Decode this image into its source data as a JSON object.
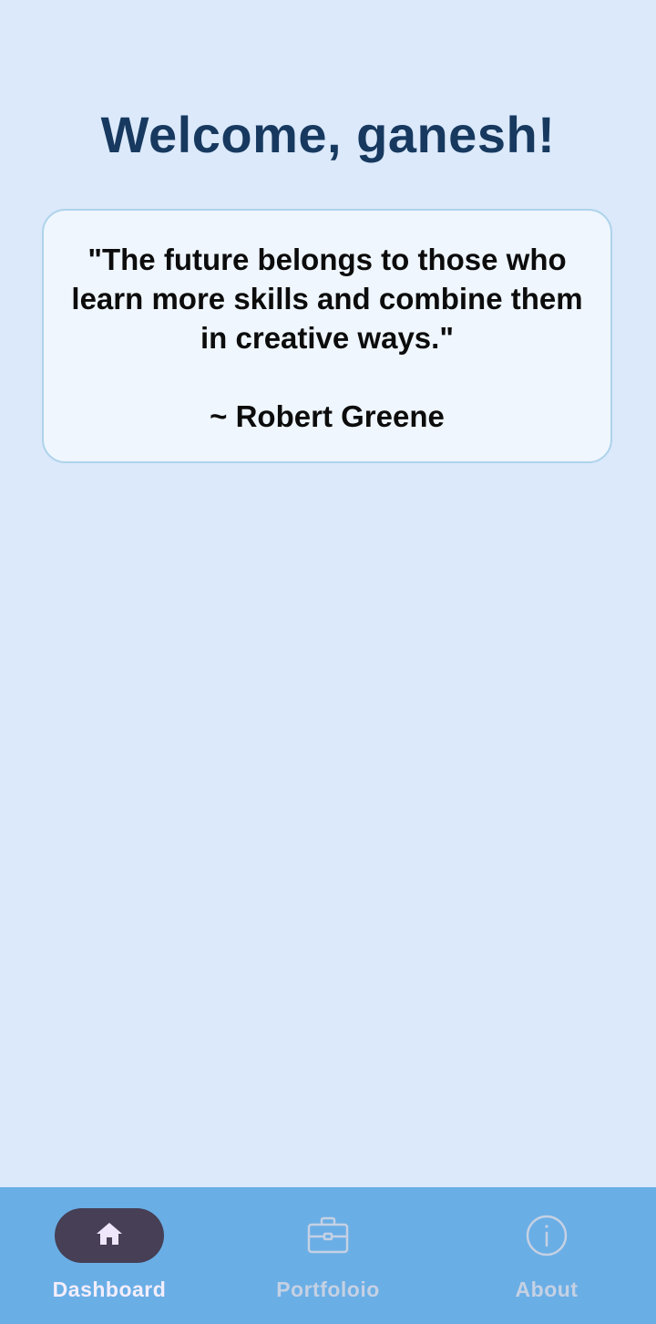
{
  "greeting": {
    "title": "Welcome, ganesh!"
  },
  "quote": {
    "text": "\"The future belongs to those who learn more skills and combine them in creative ways.\"",
    "author": "~ Robert Greene"
  },
  "bottom_nav": {
    "active_index": 0,
    "items": [
      {
        "label": "Dashboard",
        "icon": "home-icon"
      },
      {
        "label": "Portfoloio",
        "icon": "briefcase-icon"
      },
      {
        "label": "About",
        "icon": "info-icon"
      }
    ]
  },
  "colors": {
    "background": "#dbe9fb",
    "title": "#17395f",
    "card_background": "#eff6fe",
    "card_border": "#aed3ea",
    "nav_background": "#6aaee6",
    "nav_active_pill": "#463f55",
    "nav_active_text": "#f3eefb",
    "nav_inactive": "#c5d1e3"
  }
}
